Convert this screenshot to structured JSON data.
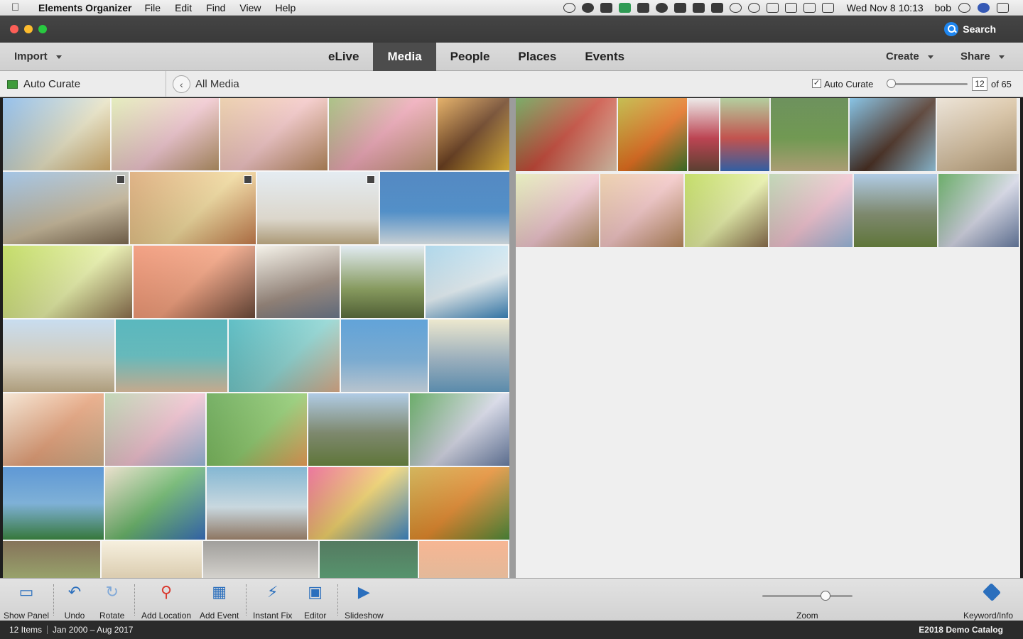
{
  "menubar": {
    "app_name": "Elements Organizer",
    "menus": [
      "File",
      "Edit",
      "Find",
      "View",
      "Help"
    ],
    "clock": "Wed Nov 8  10:13",
    "user": "bob"
  },
  "titlebar": {
    "search_label": "Search"
  },
  "tabbar": {
    "import_label": "Import",
    "tabs": [
      "eLive",
      "Media",
      "People",
      "Places",
      "Events"
    ],
    "active_tab": "Media",
    "create_label": "Create",
    "share_label": "Share"
  },
  "subbar": {
    "auto_curate_panel": "Auto Curate",
    "breadcrumb": "All Media",
    "auto_curate_checkbox": "Auto Curate",
    "auto_curate_checked": true,
    "curate_count": "12",
    "curate_total": "of 65",
    "curate_level": 0.0
  },
  "toolbar": {
    "tools": [
      {
        "name": "show-panel",
        "label": "Show Panel"
      },
      {
        "name": "undo",
        "label": "Undo"
      },
      {
        "name": "rotate",
        "label": "Rotate"
      },
      {
        "name": "add-location",
        "label": "Add Location"
      },
      {
        "name": "add-event",
        "label": "Add Event"
      },
      {
        "name": "instant-fix",
        "label": "Instant Fix"
      },
      {
        "name": "editor",
        "label": "Editor"
      },
      {
        "name": "slideshow",
        "label": "Slideshow"
      }
    ],
    "zoom_label": "Zoom",
    "zoom_level": 0.7,
    "keyword_label": "Keyword/Info"
  },
  "statusbar": {
    "items": "12 Items",
    "date_range": "Jan 2000 – Aug 2017",
    "catalog": "E2018 Demo Catalog"
  },
  "colors": {
    "active_tab": "#4c4c4c",
    "accent": "#1e86f0",
    "icon_blue": "#2b6fbd"
  }
}
